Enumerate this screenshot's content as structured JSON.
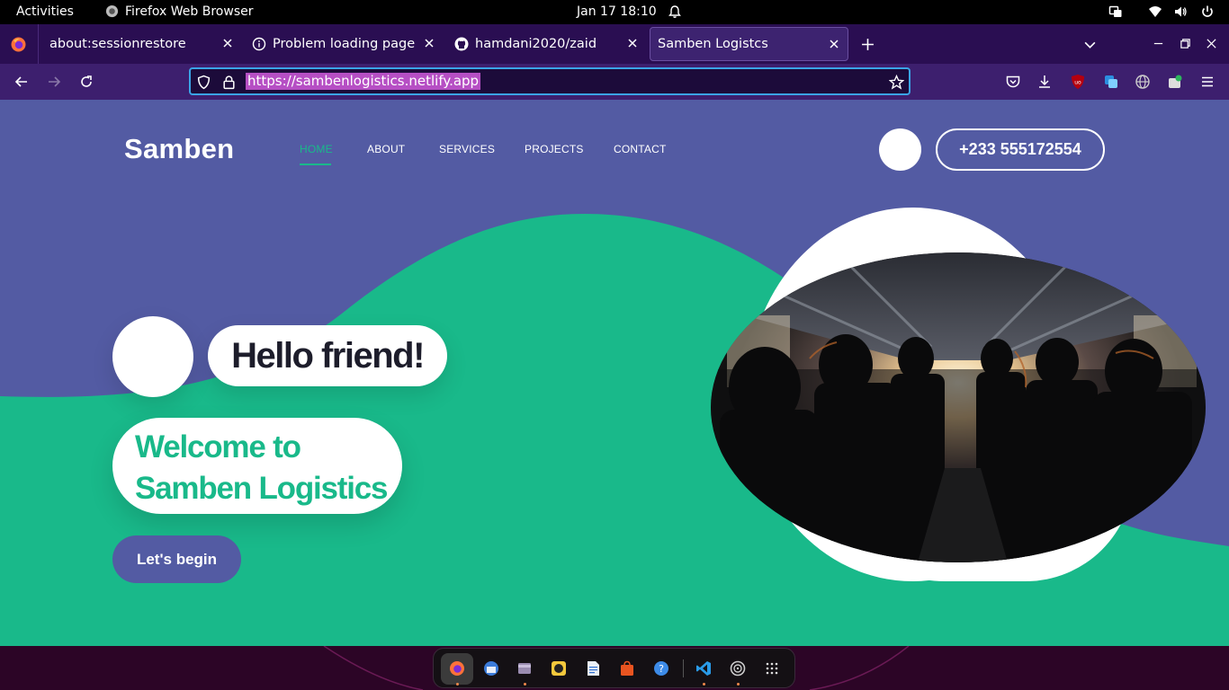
{
  "system": {
    "activities": "Activities",
    "app_name": "Firefox Web Browser",
    "clock": "Jan 17  18:10"
  },
  "browser": {
    "tabs": [
      {
        "title": "about:sessionrestore"
      },
      {
        "title": "Problem loading page"
      },
      {
        "title": "hamdani2020/zaid"
      },
      {
        "title": "Samben Logistcs"
      }
    ],
    "url": "https://sambenlogistics.netlify.app"
  },
  "site": {
    "brand": "Samben",
    "nav": [
      "HOME",
      "ABOUT",
      "SERVICES",
      "PROJECTS",
      "CONTACT"
    ],
    "active_nav": "HOME",
    "phone": "+233 555172554",
    "hero": {
      "greeting": "Hello friend!",
      "welcome_line1": "Welcome to",
      "welcome_line2": "Samben Logistics",
      "cta": "Let's begin"
    },
    "colors": {
      "primary": "#535ba3",
      "accent": "#19b98a"
    }
  }
}
